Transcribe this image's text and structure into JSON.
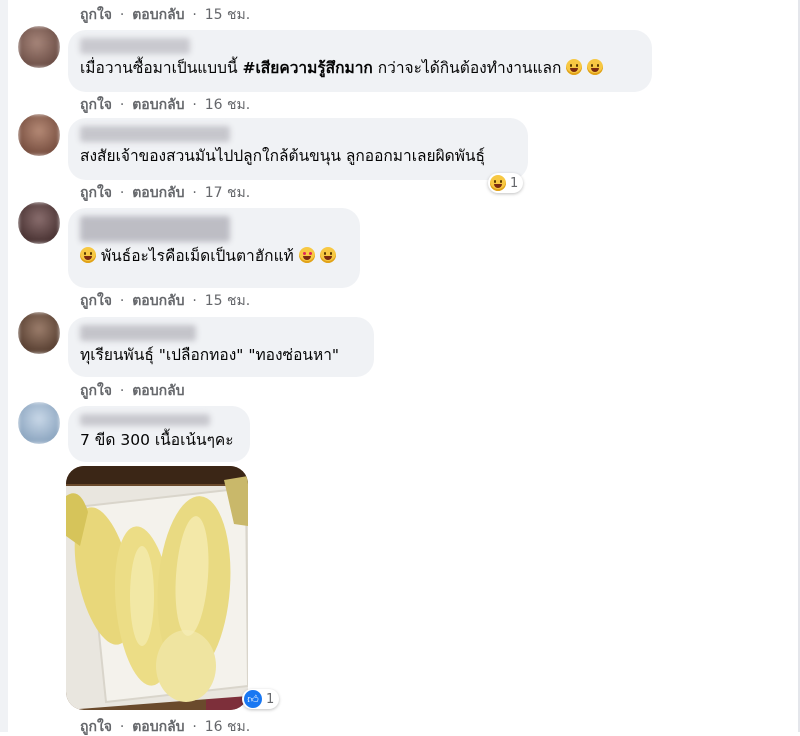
{
  "actions": {
    "like": "ถูกใจ",
    "reply": "ตอบกลับ",
    "sep": "·"
  },
  "comments": [
    {
      "time": "15 ชม."
    },
    {
      "text_before": "เมื่อวานซื้อมาเป็นแบบนี้ ",
      "hashtag": "#เสียความรู้สึกมาก",
      "text_after": " กว่าจะได้กินต้องทำงานแลก",
      "time": "16 ชม."
    },
    {
      "text": "สงสัยเจ้าของสวนมันไปปลูกใกล้ต้นขนุน ลูกออกมาเลยผิดพันธุ์",
      "time": "17 ชม.",
      "reaction_count": "1"
    },
    {
      "text": "พันธ์อะไรคือเม็ดเป็นตาฮักแท้",
      "time": "15 ชม."
    },
    {
      "text": "ทุเรียนพันธุ์ \"เปลือกทอง\" \"ทองซ่อนหา\"",
      "time": ""
    },
    {
      "text": "7 ขีด 300 เนื้อเน้นๆคะ",
      "time": "16 ชม.",
      "reaction_count": "1"
    }
  ],
  "icons": {
    "laugh": "laughing-emoji-icon",
    "love": "smiling-hearts-emoji-icon",
    "like": "like-thumb-icon"
  },
  "colors": {
    "bubble": "#f0f2f5",
    "meta": "#65676b",
    "like_blue": "#1877f2"
  }
}
